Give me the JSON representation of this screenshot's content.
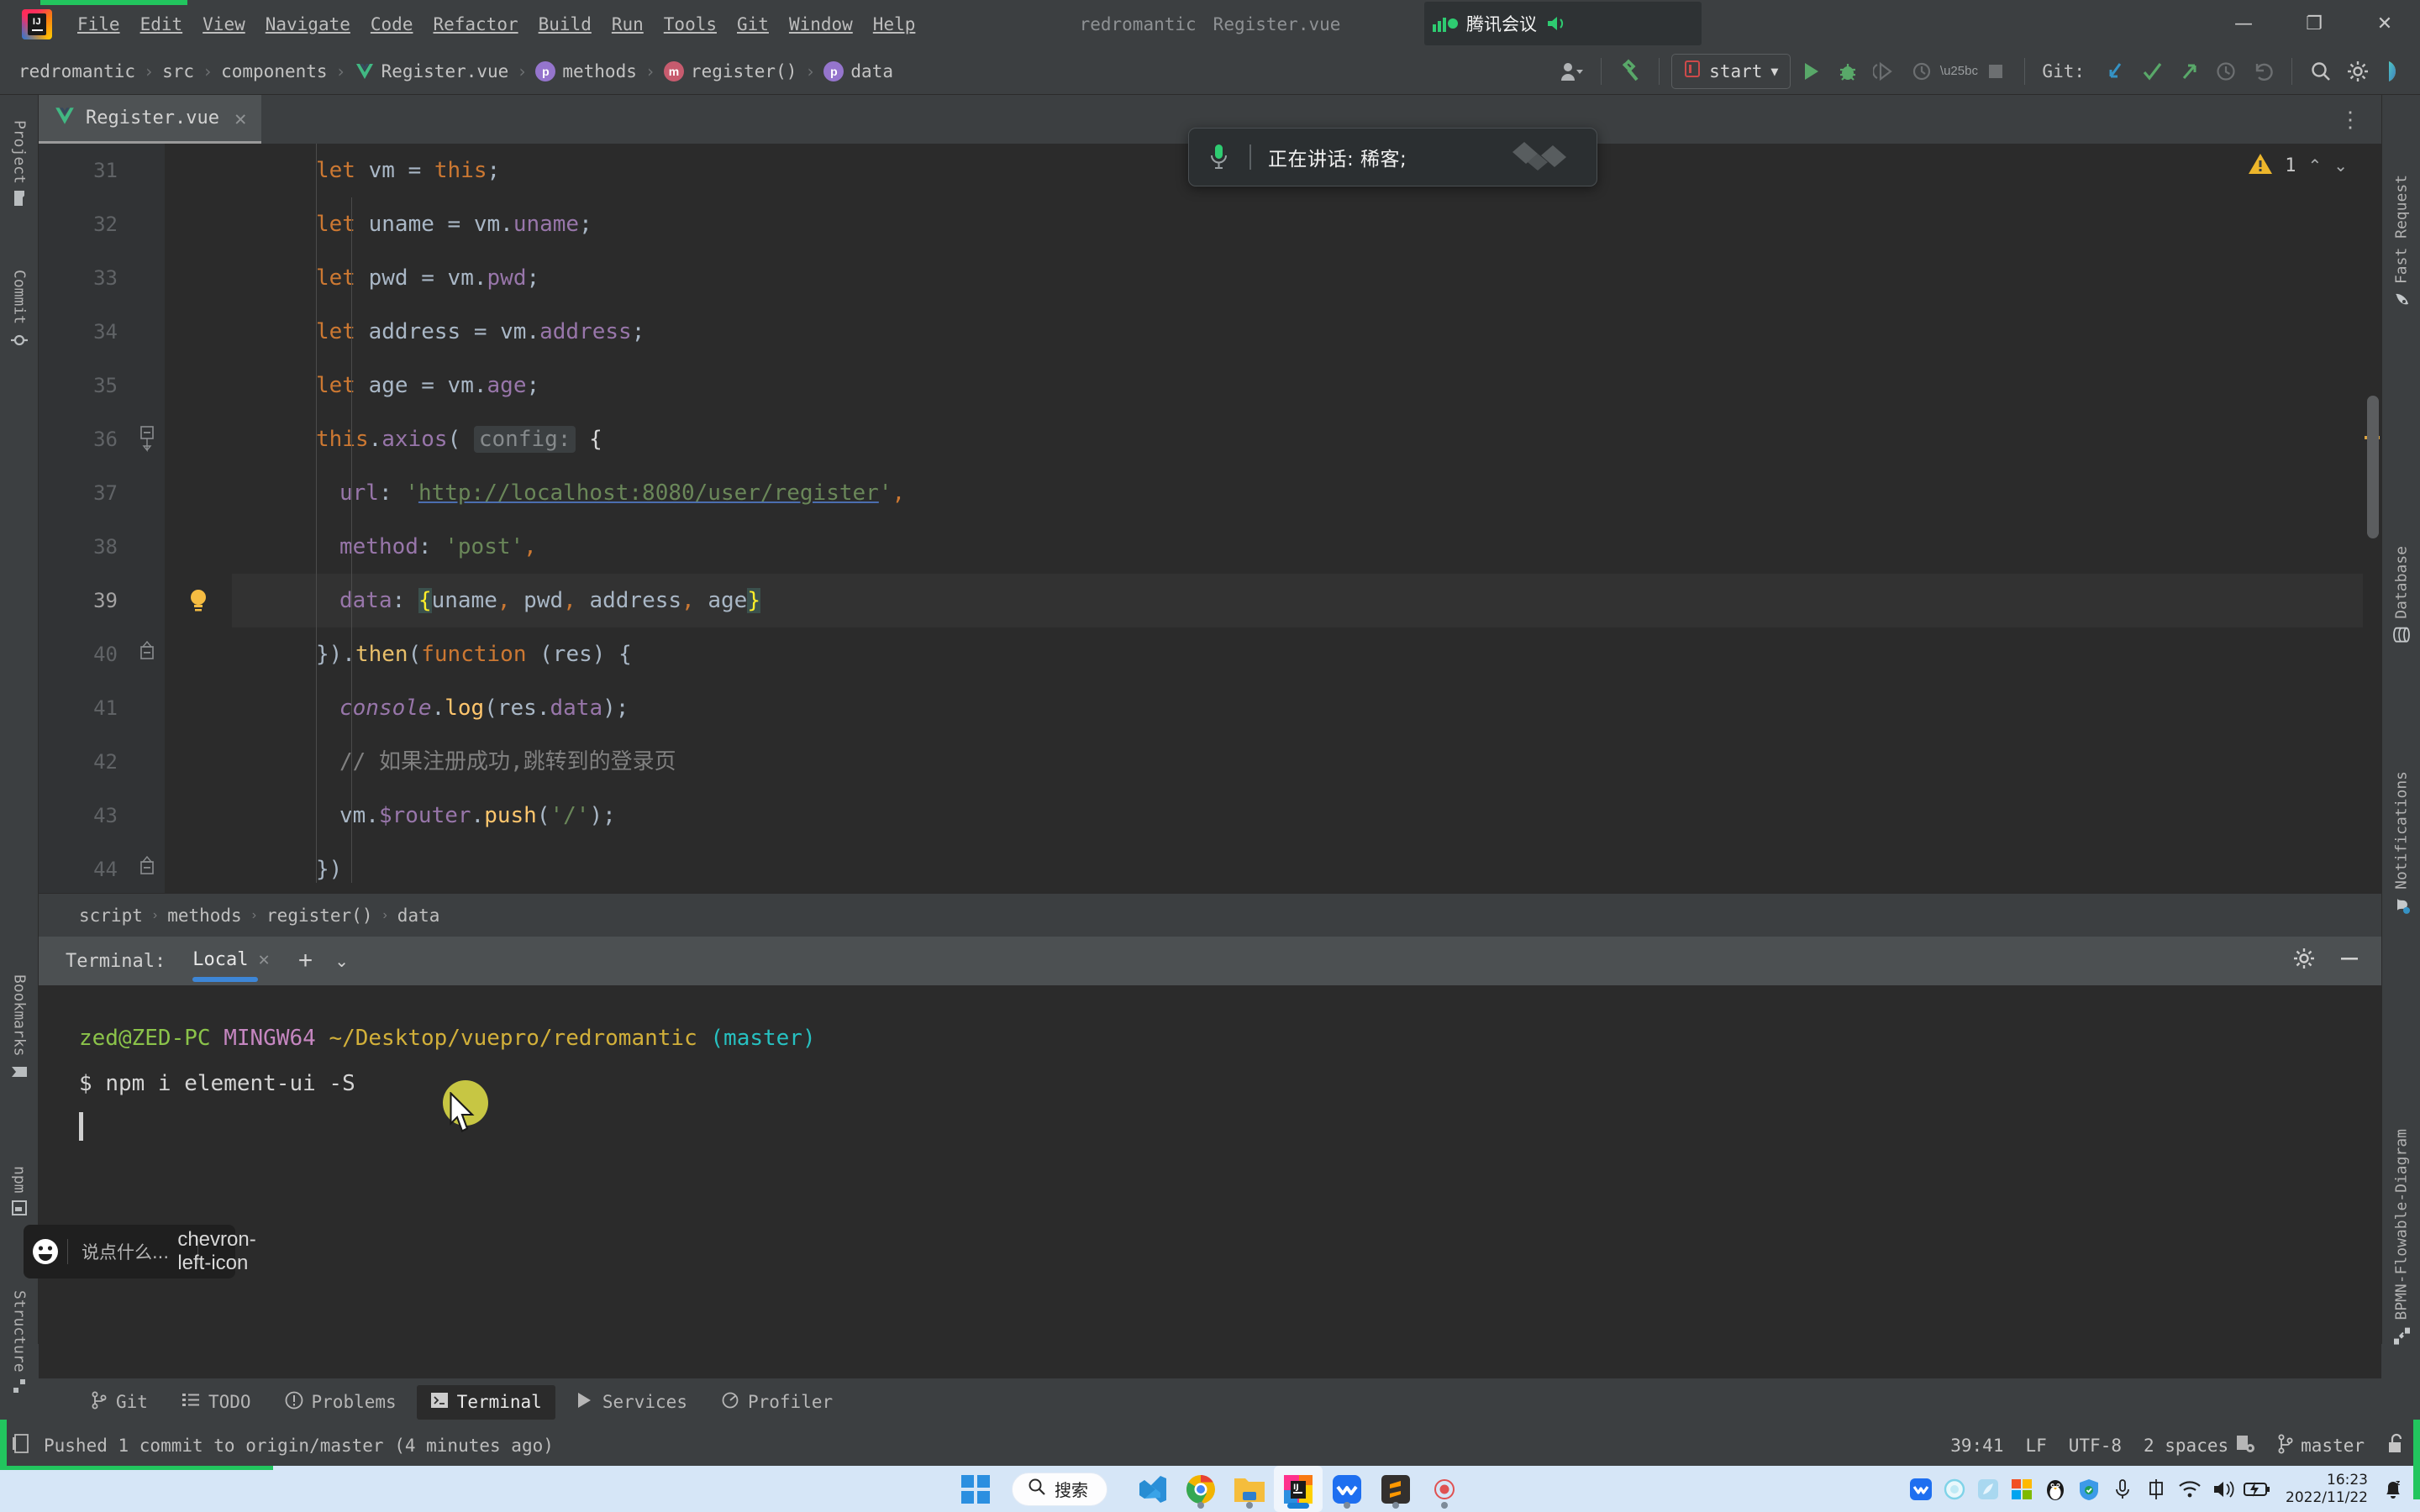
{
  "app": {
    "title_project": "redromantic",
    "title_file": "Register.vue"
  },
  "menu": {
    "items": [
      {
        "label": "File"
      },
      {
        "label": "Edit"
      },
      {
        "label": "View"
      },
      {
        "label": "Navigate"
      },
      {
        "label": "Code"
      },
      {
        "label": "Refactor"
      },
      {
        "label": "Build"
      },
      {
        "label": "Run"
      },
      {
        "label": "Tools"
      },
      {
        "label": "Git"
      },
      {
        "label": "Window"
      },
      {
        "label": "Help"
      }
    ]
  },
  "window_controls": {
    "minimize": "—",
    "maximize": "❐",
    "close": "✕"
  },
  "tencent_meeting": {
    "tray_label": "腾讯会议",
    "speaking_text": "正在讲话: 稀客;",
    "mic_icon": "microphone-icon",
    "speaker_icon": "speaker-icon",
    "signal_icon": "signal-bars-icon"
  },
  "breadcrumb": {
    "items": [
      {
        "label": "redromantic",
        "icon": ""
      },
      {
        "label": "src",
        "icon": ""
      },
      {
        "label": "components",
        "icon": ""
      },
      {
        "label": "Register.vue",
        "icon": "vue-icon"
      },
      {
        "label": "methods",
        "icon": "property-icon",
        "badge": "p",
        "badge_color": "#9575cd"
      },
      {
        "label": "register()",
        "icon": "method-icon",
        "badge": "m",
        "badge_color": "#c75b6e"
      },
      {
        "label": "data",
        "icon": "property-icon",
        "badge": "p",
        "badge_color": "#9575cd"
      }
    ],
    "separator": "›"
  },
  "toolbar": {
    "run_config": "start",
    "run_config_dropdown": "▼",
    "run_icon": "run-play-icon",
    "debug_icon": "debug-bug-icon",
    "coverage_icon": "run-coverage-icon",
    "profile_icon": "run-profile-icon",
    "stop_icon": "stop-square-icon",
    "git_label": "Git:",
    "git_update_icon": "git-update-arrow-icon",
    "git_commit_icon": "git-commit-check-icon",
    "git_push_icon": "git-push-arrow-icon",
    "git_history_icon": "git-history-clock-icon",
    "git_rollback_icon": "git-rollback-icon",
    "search_icon": "search-icon",
    "settings_icon": "gear-icon",
    "avatar_icon": "user-avatar-icon",
    "hammer_icon": "build-hammer-icon",
    "ai_icon": "ai-assistant-icon"
  },
  "left_tool_strip": [
    {
      "label": "Project",
      "icon": "folder-icon"
    },
    {
      "label": "Commit",
      "icon": "commit-diamond-icon"
    },
    {
      "label": "Bookmarks",
      "icon": "bookmark-icon"
    },
    {
      "label": "npm",
      "icon": "npm-square-icon"
    },
    {
      "label": "Structure",
      "icon": "structure-icon"
    }
  ],
  "right_tool_strip": [
    {
      "label": "Fast Request",
      "icon": "rocket-icon"
    },
    {
      "label": "Database",
      "icon": "database-icon"
    },
    {
      "label": "Notifications",
      "icon": "bell-icon"
    },
    {
      "label": "BPMN-Flowable-Diagram",
      "icon": "bpmn-diagram-icon"
    }
  ],
  "editor": {
    "tab": {
      "label": "Register.vue",
      "icon": "vue-icon",
      "close": "✕"
    },
    "tab_more": "⋮",
    "inspection": {
      "warning_count": "1",
      "warn_icon": "warning-triangle-icon",
      "up": "⌃",
      "down": "⌄"
    },
    "lines": [
      {
        "num": "31",
        "indent": 4
      },
      {
        "num": "32",
        "indent": 4
      },
      {
        "num": "33",
        "indent": 4
      },
      {
        "num": "34",
        "indent": 4
      },
      {
        "num": "35",
        "indent": 4
      },
      {
        "num": "36",
        "indent": 4,
        "fold": "minus"
      },
      {
        "num": "37",
        "indent": 6
      },
      {
        "num": "38",
        "indent": 6
      },
      {
        "num": "39",
        "indent": 6,
        "bulb": true,
        "current": true
      },
      {
        "num": "40",
        "indent": 4,
        "fold": "up"
      },
      {
        "num": "41",
        "indent": 6
      },
      {
        "num": "42",
        "indent": 6
      },
      {
        "num": "43",
        "indent": 6
      },
      {
        "num": "44",
        "indent": 4,
        "fold": "up"
      }
    ],
    "code_text": [
      "let vm = this;",
      "let uname = vm.uname;",
      "let pwd = vm.pwd;",
      "let address = vm.address;",
      "let age = vm.age;",
      "this.axios( config: {",
      "url: 'http://localhost:8080/user/register',",
      "method: 'post',",
      "data: {uname, pwd, address, age}",
      "}).then(function (res) {",
      "console.log(res.data);",
      "// 如果注册成功,跳转到的登录页",
      "vm.$router.push('/');",
      "})"
    ],
    "hint_config": "config:",
    "url_value": "http://localhost:8080/user/register"
  },
  "sub_breadcrumb": {
    "items": [
      "script",
      "methods",
      "register()",
      "data"
    ],
    "separator": "›"
  },
  "terminal": {
    "header_label": "Terminal:",
    "tab_label": "Local",
    "tab_close": "✕",
    "add": "+",
    "dropdown": "⌄",
    "settings_icon": "gear-icon",
    "minimize_icon": "minimize-icon",
    "prompt_user": "zed@ZED-PC",
    "prompt_shell": "MINGW64",
    "prompt_path": "~/Desktop/vuepro/redromantic",
    "prompt_branch": "(master)",
    "command_prefix": "$",
    "command": "npm i element-ui -S"
  },
  "chat_widget": {
    "placeholder": "说点什么...",
    "emoji_icon": "smiley-face-icon",
    "collapse_icon": "chevron-left-icon"
  },
  "bottom_tabs": [
    {
      "label": "Git",
      "icon": "git-branch-icon",
      "active": false
    },
    {
      "label": "TODO",
      "icon": "todo-list-icon",
      "active": false
    },
    {
      "label": "Problems",
      "icon": "problems-icon",
      "active": false
    },
    {
      "label": "Terminal",
      "icon": "terminal-icon",
      "active": true
    },
    {
      "label": "Services",
      "icon": "services-play-icon",
      "active": false
    },
    {
      "label": "Profiler",
      "icon": "profiler-icon",
      "active": false
    }
  ],
  "status_bar": {
    "message": "Pushed 1 commit to origin/master (4 minutes ago)",
    "message_icon": "event-log-icon",
    "caret_position": "39:41",
    "line_separator": "LF",
    "encoding": "UTF-8",
    "indent": "2 spaces",
    "indent_icon": "indent-config-icon",
    "branch": "master",
    "branch_icon": "git-branch-icon",
    "lock_icon": "unlocked-padlock-icon"
  },
  "taskbar": {
    "start_icon": "windows-start-icon",
    "search_label": "搜索",
    "search_icon": "search-icon",
    "apps": [
      {
        "name": "vscode-icon",
        "running": false
      },
      {
        "name": "chrome-icon",
        "running": true
      },
      {
        "name": "file-explorer-icon",
        "running": true
      },
      {
        "name": "intellij-idea-icon",
        "running": true,
        "active": true
      },
      {
        "name": "tencent-meeting-icon",
        "running": true
      },
      {
        "name": "sublime-text-icon",
        "running": true
      },
      {
        "name": "recorder-icon",
        "running": true
      }
    ],
    "tray": [
      {
        "name": "tencent-meeting-tray-icon"
      },
      {
        "name": "circle-tray-icon"
      },
      {
        "name": "blue-app-tray-icon"
      },
      {
        "name": "microsoft-office-tray-icon"
      },
      {
        "name": "qq-penguin-tray-icon"
      },
      {
        "name": "security-shield-tray-icon"
      },
      {
        "name": "microphone-tray-icon"
      },
      {
        "name": "ime-chinese-tray-icon"
      },
      {
        "name": "wifi-tray-icon"
      },
      {
        "name": "volume-tray-icon"
      },
      {
        "name": "battery-charging-tray-icon"
      }
    ],
    "clock_time": "16:23",
    "clock_date": "2022/11/22",
    "notification_icon": "do-not-disturb-bell-icon"
  }
}
